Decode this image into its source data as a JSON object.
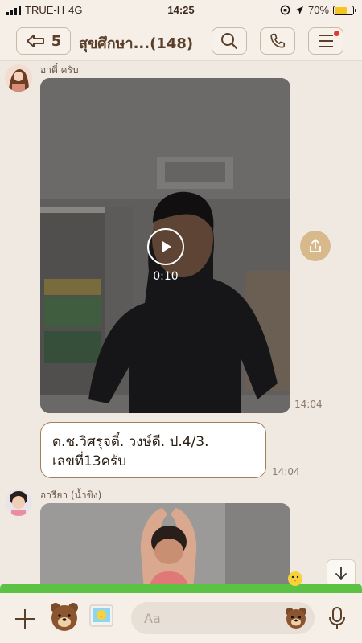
{
  "status_bar": {
    "carrier": "TRUE-H",
    "network": "4G",
    "time": "14:25",
    "battery": "70%",
    "battery_level": 0.7
  },
  "header": {
    "back_count": "5",
    "title": "สุขศึกษา...(148)"
  },
  "messages": [
    {
      "sender": "อาตี๋ ครับ",
      "video_duration": "0:10",
      "video_time": "14:04"
    },
    {
      "text_line1": "ด.ช.วิศรุจติ์.   วงษ์ดี.   ป.4/3.",
      "text_line2": "เลขที่13ครับ",
      "time": "14:04"
    },
    {
      "sender": "อารียา (น้ำขิง)"
    }
  ],
  "input": {
    "placeholder": "Aa"
  },
  "colors": {
    "background": "#f0e9e1",
    "accent": "#d7b98b",
    "bubble_border": "#a37e5c",
    "grass": "#5cc244"
  }
}
